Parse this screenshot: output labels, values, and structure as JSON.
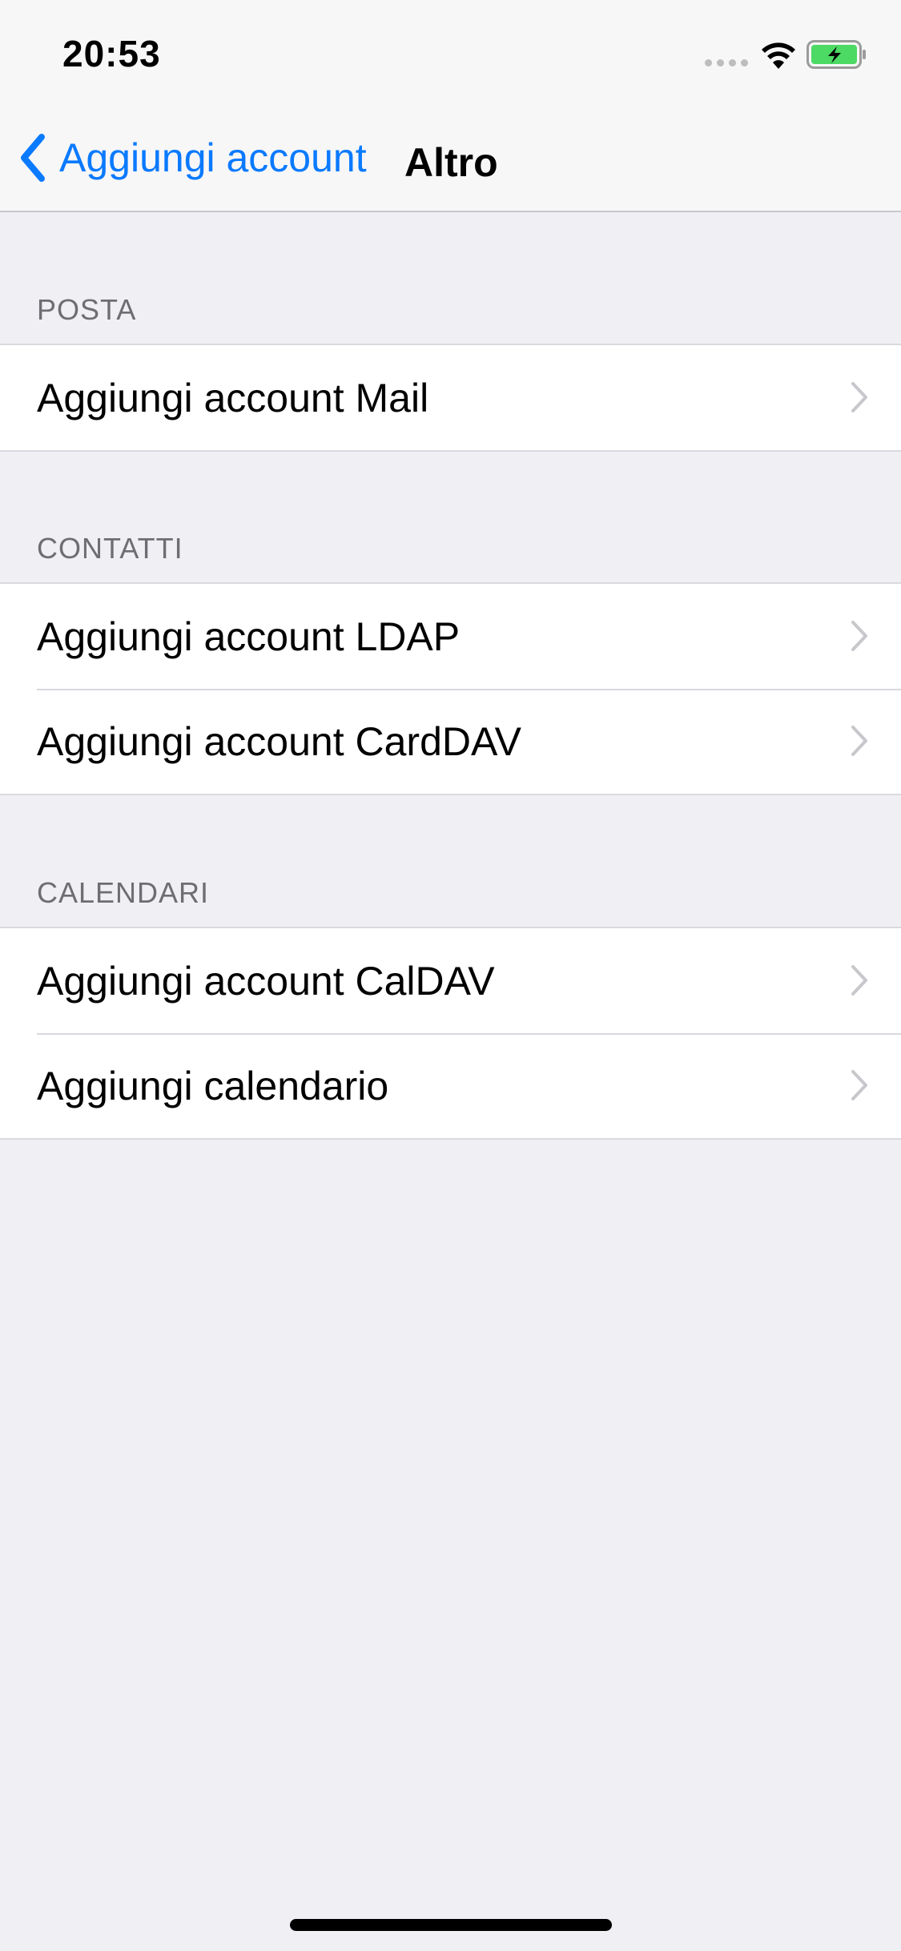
{
  "status_bar": {
    "time": "20:53"
  },
  "nav": {
    "back_label": "Aggiungi account",
    "title": "Altro"
  },
  "sections": [
    {
      "header": "POSTA",
      "items": [
        "Aggiungi account Mail"
      ]
    },
    {
      "header": "CONTATTI",
      "items": [
        "Aggiungi account LDAP",
        "Aggiungi account CardDAV"
      ]
    },
    {
      "header": "CALENDARI",
      "items": [
        "Aggiungi account CalDAV",
        "Aggiungi calendario"
      ]
    }
  ],
  "colors": {
    "accent": "#0A7AFF",
    "background": "#EFEFF4",
    "battery_fill": "#4CD964"
  },
  "icons": [
    "back-chevron-icon",
    "wifi-icon",
    "battery-charging-icon",
    "chevron-right-icon"
  ]
}
